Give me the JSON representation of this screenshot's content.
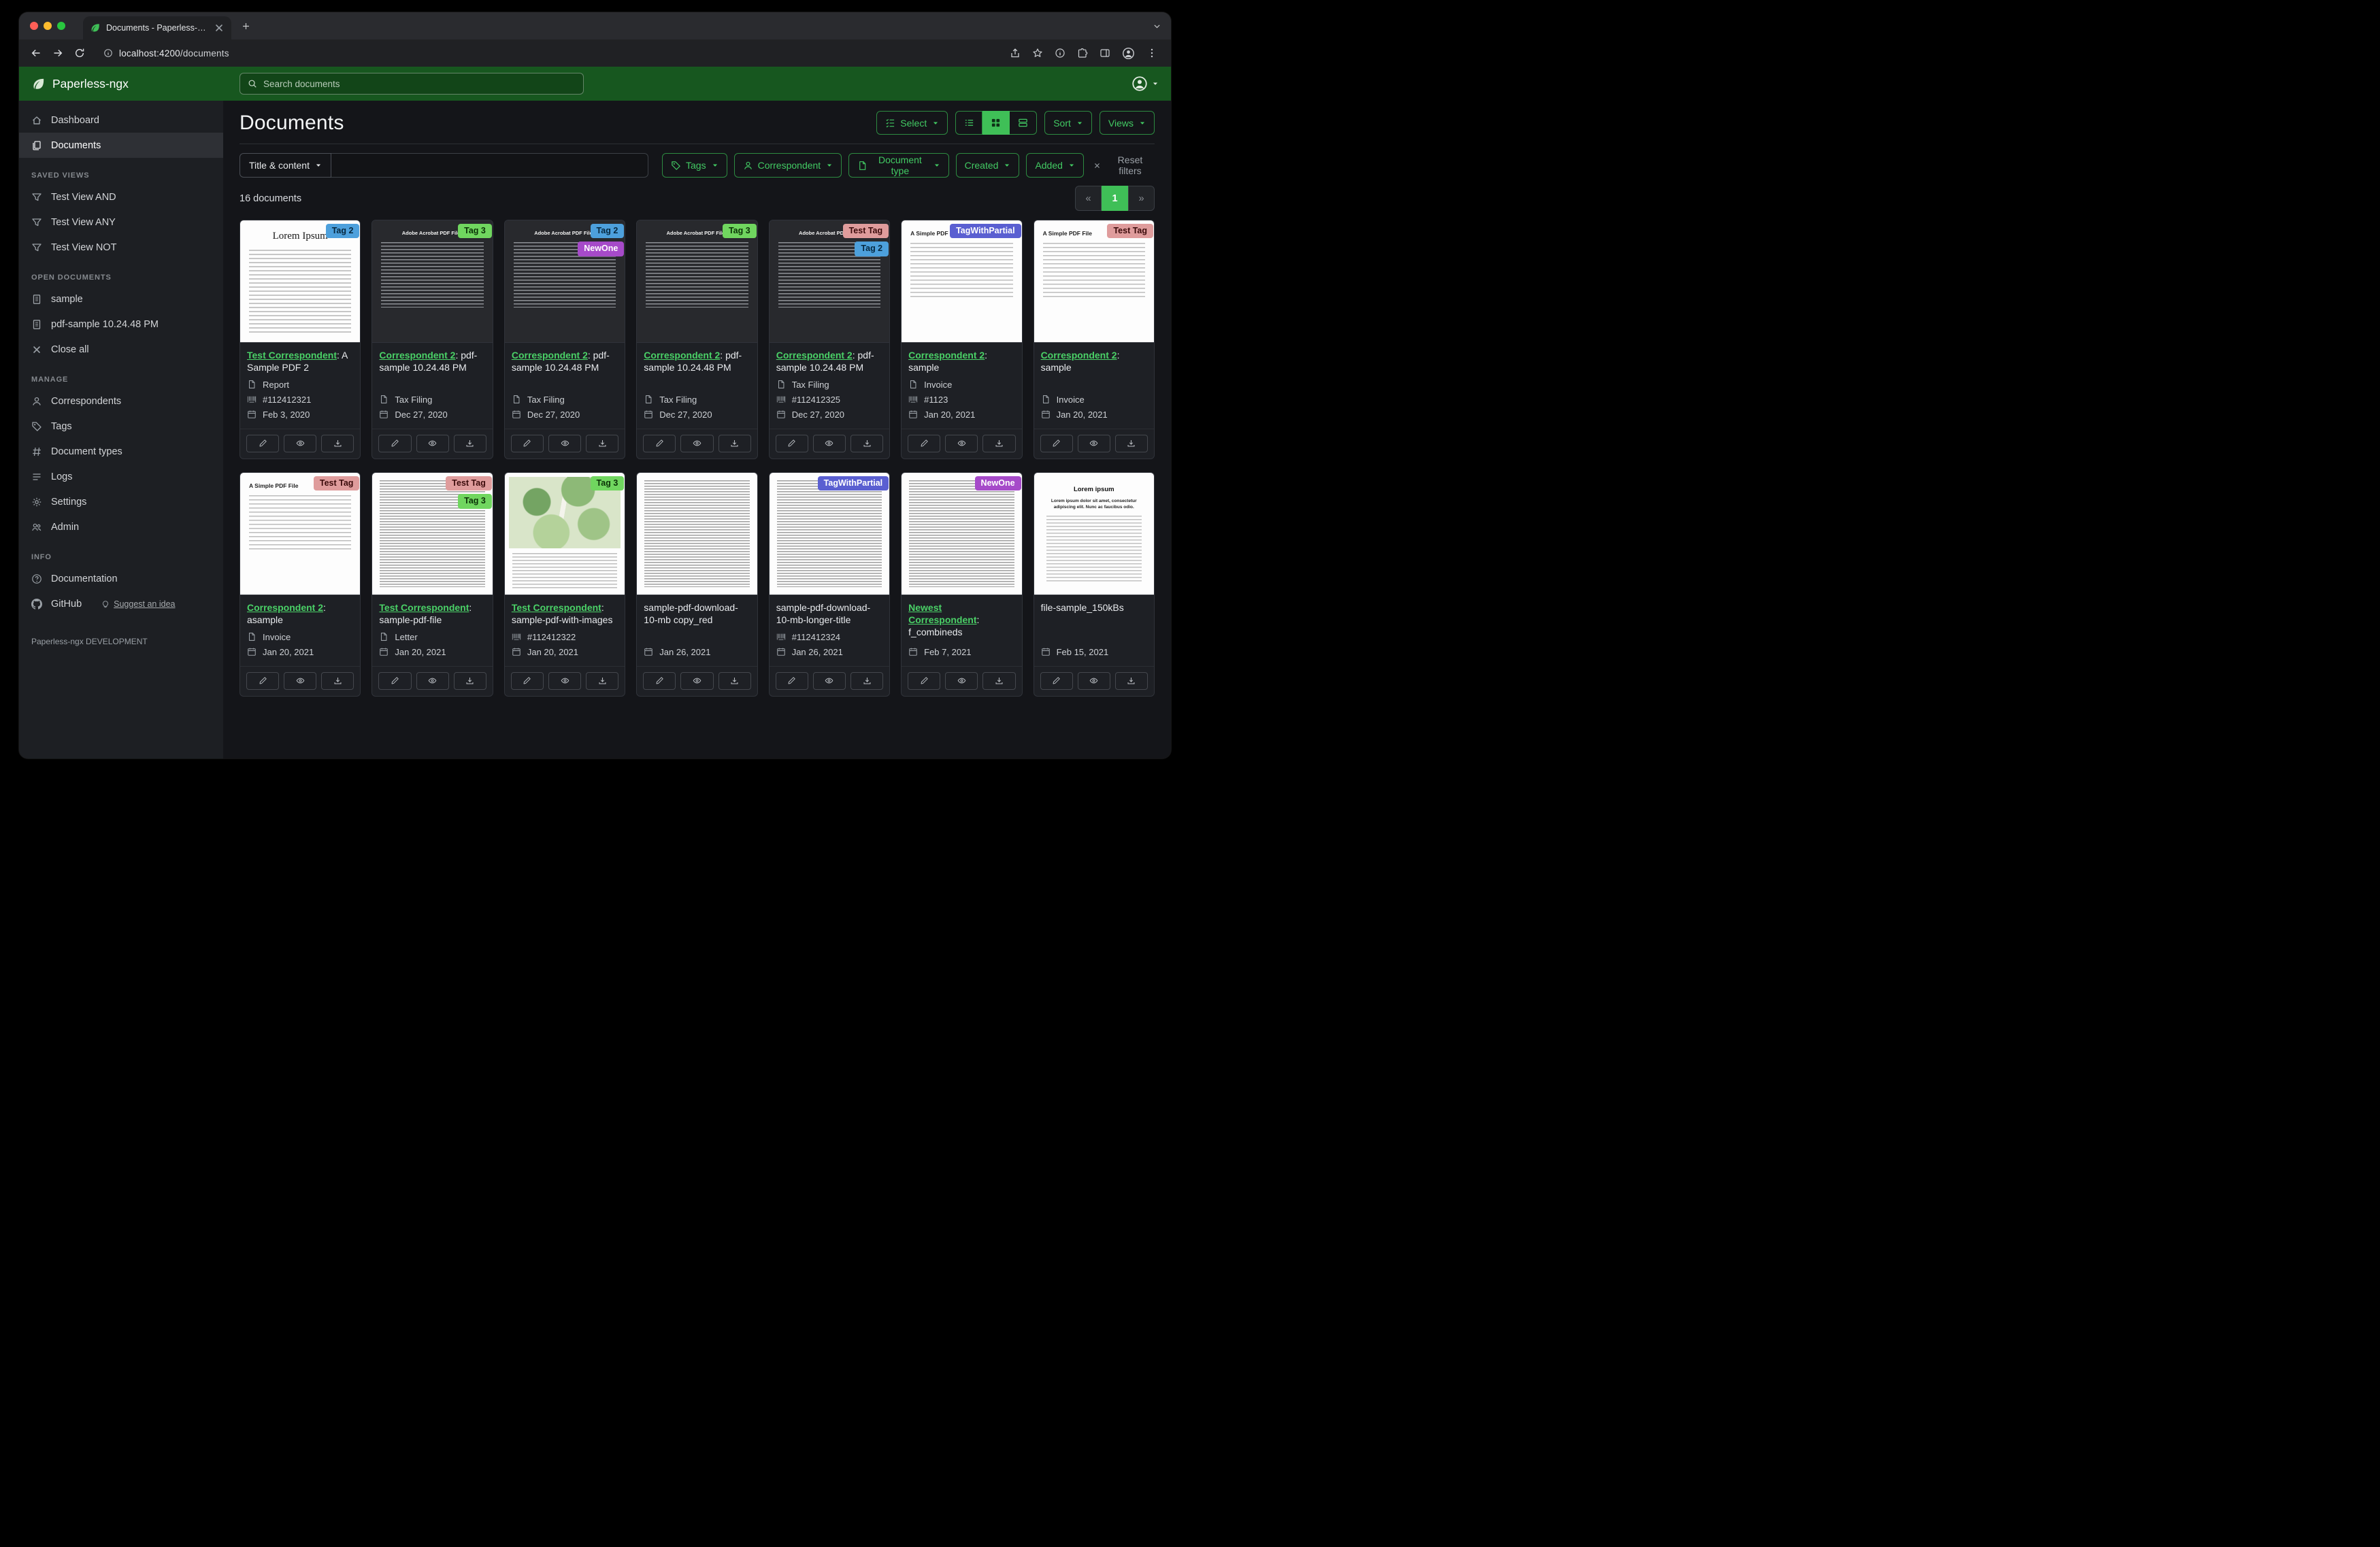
{
  "colors": {
    "accent": "#42ca63",
    "accent_border": "#2d8b41",
    "header_green": "#17571f",
    "link_green": "#4ad167",
    "active_fill": "#3fbf57"
  },
  "browser": {
    "tab_title": "Documents - Paperless-ngx",
    "url_host": "localhost:4200",
    "url_path": "/documents"
  },
  "header": {
    "brand": "Paperless-ngx",
    "search_placeholder": "Search documents"
  },
  "sidebar": {
    "primary": [
      {
        "label": "Dashboard",
        "icon": "home",
        "active": false
      },
      {
        "label": "Documents",
        "icon": "files",
        "active": true
      }
    ],
    "sections": [
      {
        "title": "SAVED VIEWS",
        "items": [
          {
            "label": "Test View AND",
            "icon": "funnel"
          },
          {
            "label": "Test View ANY",
            "icon": "funnel"
          },
          {
            "label": "Test View NOT",
            "icon": "funnel"
          }
        ]
      },
      {
        "title": "OPEN DOCUMENTS",
        "items": [
          {
            "label": "sample",
            "icon": "doc"
          },
          {
            "label": "pdf-sample 10.24.48 PM",
            "icon": "doc"
          },
          {
            "label": "Close all",
            "icon": "x"
          }
        ]
      },
      {
        "title": "MANAGE",
        "items": [
          {
            "label": "Correspondents",
            "icon": "person"
          },
          {
            "label": "Tags",
            "icon": "tag"
          },
          {
            "label": "Document types",
            "icon": "hash"
          },
          {
            "label": "Logs",
            "icon": "logs"
          },
          {
            "label": "Settings",
            "icon": "gear"
          },
          {
            "label": "Admin",
            "icon": "people"
          }
        ]
      },
      {
        "title": "INFO",
        "items": [
          {
            "label": "Documentation",
            "icon": "question"
          },
          {
            "label": "GitHub",
            "icon": "github",
            "sublink": "Suggest an idea"
          }
        ]
      }
    ],
    "footer": "Paperless-ngx DEVELOPMENT"
  },
  "main": {
    "title": "Documents",
    "select_label": "Select",
    "sort_label": "Sort",
    "views_label": "Views",
    "count": "16 documents",
    "filters": {
      "field_label": "Title & content",
      "input_value": "",
      "buttons": [
        {
          "label": "Tags",
          "icon": "tag"
        },
        {
          "label": "Correspondent",
          "icon": "person"
        },
        {
          "label": "Document type",
          "icon": "file"
        },
        {
          "label": "Created",
          "icon": null
        },
        {
          "label": "Added",
          "icon": null
        }
      ],
      "reset_label": "Reset filters"
    },
    "pagination": {
      "prev": "«",
      "page": "1",
      "next": "»"
    }
  },
  "tag_styles": {
    "Tag 2": {
      "bg": "#4da0dc",
      "fg": "#06283f"
    },
    "Tag 3": {
      "bg": "#70d65f",
      "fg": "#0b3307"
    },
    "Test Tag": {
      "bg": "#df9c9c",
      "fg": "#3b0b0b"
    },
    "NewOne": {
      "bg": "#a64ac9",
      "fg": "#ffffff"
    },
    "TagWithPartial": {
      "bg": "#5a5fd1",
      "fg": "#ffffff"
    }
  },
  "cards": [
    {
      "thumb": "lorem",
      "heading": "Lorem Ipsum",
      "tags": [
        "Tag 2"
      ],
      "correspondent": "Test Correspondent",
      "title": ": A Sample PDF 2",
      "type": "Report",
      "asn": "#112412321",
      "date": "Feb 3, 2020"
    },
    {
      "thumb": "acrobat",
      "heading": "Adobe Acrobat PDF Files",
      "tags": [
        "Tag 3"
      ],
      "correspondent": "Correspondent 2",
      "title": ": pdf-sample 10.24.48 PM",
      "type": "Tax Filing",
      "asn": null,
      "date": "Dec 27, 2020"
    },
    {
      "thumb": "acrobat",
      "heading": "Adobe Acrobat PDF Files",
      "tags": [
        "Tag 2",
        "NewOne"
      ],
      "correspondent": "Correspondent 2",
      "title": ": pdf-sample 10.24.48 PM",
      "type": "Tax Filing",
      "asn": null,
      "date": "Dec 27, 2020"
    },
    {
      "thumb": "acrobat",
      "heading": "Adobe Acrobat PDF Files",
      "tags": [
        "Tag 3"
      ],
      "correspondent": "Correspondent 2",
      "title": ": pdf-sample 10.24.48 PM",
      "type": "Tax Filing",
      "asn": null,
      "date": "Dec 27, 2020"
    },
    {
      "thumb": "acrobat",
      "heading": "Adobe Acrobat PDF Files",
      "tags": [
        "Test Tag",
        "Tag 2"
      ],
      "correspondent": "Correspondent 2",
      "title": ": pdf-sample 10.24.48 PM",
      "type": "Tax Filing",
      "asn": "#112412325",
      "date": "Dec 27, 2020"
    },
    {
      "thumb": "simple",
      "heading": "A Simple PDF File",
      "tags": [
        "TagWithPartial"
      ],
      "correspondent": "Correspondent 2",
      "title": ": sample",
      "type": "Invoice",
      "asn": "#1123",
      "date": "Jan 20, 2021"
    },
    {
      "thumb": "simple",
      "heading": "A Simple PDF File",
      "tags": [
        "Test Tag"
      ],
      "correspondent": "Correspondent 2",
      "title": ": sample",
      "type": "Invoice",
      "asn": null,
      "date": "Jan 20, 2021"
    },
    {
      "thumb": "simple",
      "heading": "A Simple PDF File",
      "tags": [
        "Test Tag"
      ],
      "correspondent": "Correspondent 2",
      "title": ": asample",
      "type": "Invoice",
      "asn": null,
      "date": "Jan 20, 2021"
    },
    {
      "thumb": "dense",
      "heading": null,
      "tags": [
        "Test Tag",
        "Tag 3"
      ],
      "correspondent": "Test Correspondent",
      "title": ": sample-pdf-file",
      "type": "Letter",
      "asn": null,
      "date": "Jan 20, 2021"
    },
    {
      "thumb": "map",
      "heading": null,
      "tags": [
        "Tag 3"
      ],
      "correspondent": "Test Correspondent",
      "title": ": sample-pdf-with-images",
      "type": null,
      "asn": "#112412322",
      "date": "Jan 20, 2021"
    },
    {
      "thumb": "dense",
      "heading": null,
      "tags": [],
      "correspondent": null,
      "title": "sample-pdf-download-10-mb copy_red",
      "type": null,
      "asn": null,
      "date": "Jan 26, 2021"
    },
    {
      "thumb": "dense",
      "heading": null,
      "tags": [
        "TagWithPartial"
      ],
      "correspondent": null,
      "title": "sample-pdf-download-10-mb-longer-title",
      "type": null,
      "asn": "#112412324",
      "date": "Jan 26, 2021"
    },
    {
      "thumb": "dense",
      "heading": null,
      "tags": [
        "NewOne"
      ],
      "correspondent": "Newest Correspondent",
      "title": ": f_combineds",
      "type": null,
      "asn": null,
      "date": "Feb 7, 2021"
    },
    {
      "thumb": "lorem2",
      "heading": "Lorem ipsum",
      "sub": "Lorem ipsum dolor sit amet, consectetur adipiscing elit. Nunc ac faucibus odio.",
      "tags": [],
      "correspondent": null,
      "title": "file-sample_150kBs",
      "type": null,
      "asn": null,
      "date": "Feb 15, 2021"
    }
  ]
}
